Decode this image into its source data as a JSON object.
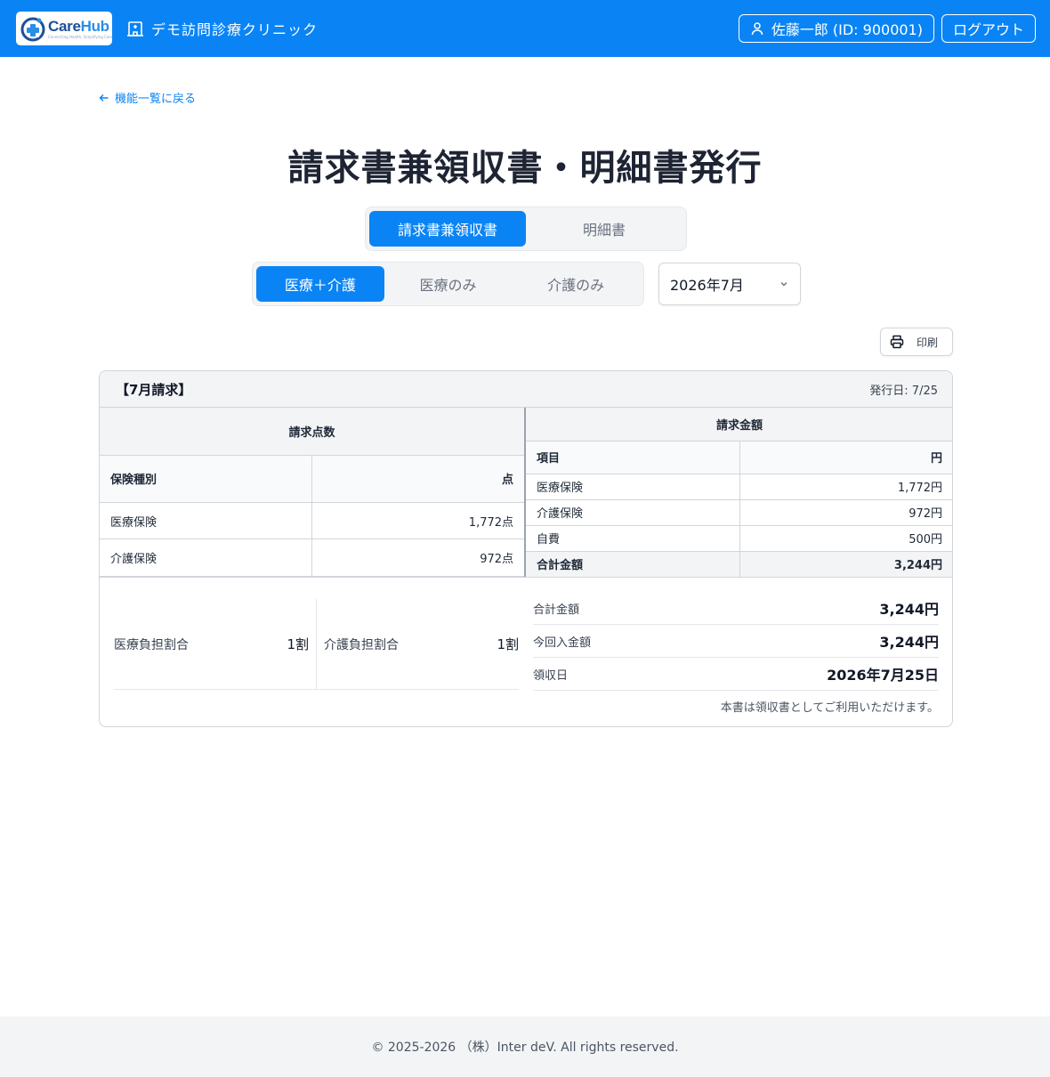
{
  "header": {
    "logo_name_a": "Care",
    "logo_name_b": "Hub",
    "logo_tagline": "Connecting Health, Simplifying Care",
    "clinic_name": "デモ訪問診療クリニック",
    "user_label": "佐藤一郎 (ID: 900001)",
    "logout_label": "ログアウト"
  },
  "back_link": "機能一覧に戻る",
  "page_title": "請求書兼領収書・明細書発行",
  "doc_tabs": [
    {
      "label": "請求書兼領収書",
      "active": true
    },
    {
      "label": "明細書",
      "active": false
    }
  ],
  "scope_tabs": [
    {
      "label": "医療＋介護",
      "active": true
    },
    {
      "label": "医療のみ",
      "active": false
    },
    {
      "label": "介護のみ",
      "active": false
    }
  ],
  "month_select": {
    "value": "2026年7月"
  },
  "print_label": "印刷",
  "invoice": {
    "title": "【7月請求】",
    "issue_date": "発行日: 7/25",
    "points": {
      "group": "請求点数",
      "col1": "保険種別",
      "col2": "点",
      "rows": [
        {
          "name": "医療保険",
          "value": "1,772点"
        },
        {
          "name": "介護保険",
          "value": "972点"
        }
      ]
    },
    "amounts": {
      "group": "請求金額",
      "col1": "項目",
      "col2": "円",
      "rows": [
        {
          "name": "医療保険",
          "value": "1,772円"
        },
        {
          "name": "介護保険",
          "value": "972円"
        },
        {
          "name": "自費",
          "value": "500円"
        }
      ],
      "total_label": "合計金額",
      "total_value": "3,244円"
    },
    "ratios": {
      "medical_label": "医療負担割合",
      "medical_value": "1割",
      "care_label": "介護負担割合",
      "care_value": "1割"
    },
    "summary": [
      {
        "label": "合計金額",
        "value": "3,244円"
      },
      {
        "label": "今回入金額",
        "value": "3,244円"
      },
      {
        "label": "領収日",
        "value": "2026年7月25日"
      }
    ],
    "note": "本書は領収書としてご利用いただけます。"
  },
  "footer": "© 2025-2026 （株）Inter deV. All rights reserved.",
  "colors": {
    "primary": "#0a84f5",
    "text": "#1e2433"
  }
}
